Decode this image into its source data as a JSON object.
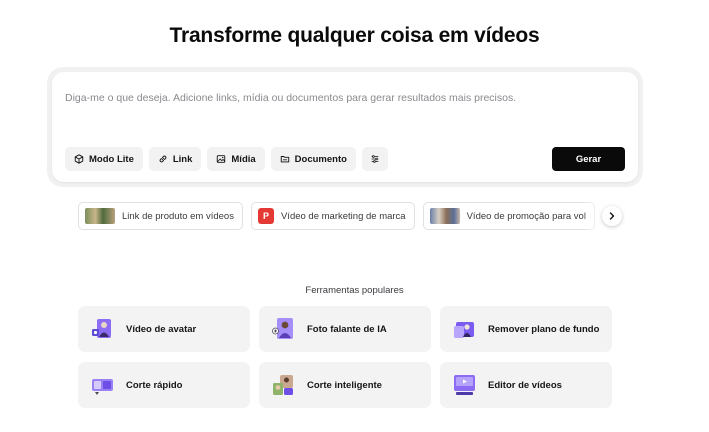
{
  "title": "Transforme qualquer coisa em vídeos",
  "prompt": {
    "placeholder": "Diga-me o que deseja. Adicione links, mídia ou documentos para gerar resultados mais precisos.",
    "value": ""
  },
  "toolbar": {
    "modo_lite": "Modo Lite",
    "link": "Link",
    "midia": "Mídia",
    "documento": "Documento",
    "gerar": "Gerar"
  },
  "suggestions": [
    {
      "label": "Link de produto em vídeos",
      "icon": "product-thumbnail"
    },
    {
      "label": "Vídeo de marketing de marca",
      "icon": "p-logo",
      "badge": "P"
    },
    {
      "label": "Vídeo de promoção para vol",
      "icon": "promo-thumbnail"
    }
  ],
  "tools_title": "Ferramentas populares",
  "tools": [
    {
      "label": "Vídeo de avatar",
      "icon": "avatar-video-icon"
    },
    {
      "label": "Foto falante de IA",
      "icon": "talking-photo-icon"
    },
    {
      "label": "Remover plano de fundo",
      "icon": "remove-background-icon"
    },
    {
      "label": "Corte rápido",
      "icon": "quick-cut-icon"
    },
    {
      "label": "Corte inteligente",
      "icon": "smart-cut-icon"
    },
    {
      "label": "Editor de vídeos",
      "icon": "video-editor-icon"
    }
  ],
  "colors": {
    "accent": "#7b5cf0",
    "button_dark": "#0a0a0a",
    "badge_red": "#e53935"
  }
}
